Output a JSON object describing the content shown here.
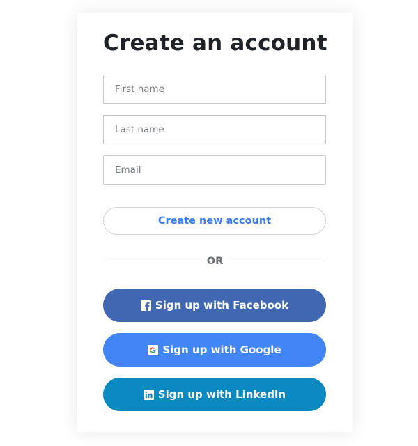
{
  "form": {
    "title": "Create an account",
    "first_name_placeholder": "First name",
    "last_name_placeholder": "Last name",
    "email_placeholder": "Email",
    "submit_label": "Create new account",
    "divider_label": "OR"
  },
  "social": {
    "facebook": {
      "label": "Sign up with Facebook",
      "icon": "facebook-icon",
      "color": "#4267b2"
    },
    "google": {
      "label": "Sign up with Google",
      "icon": "google-icon",
      "color": "#4285f4"
    },
    "linkedin": {
      "label": "Sign up with LinkedIn",
      "icon": "linkedin-icon",
      "color": "#0a8ac0"
    }
  },
  "colors": {
    "accent": "#3d7bea",
    "title": "#1f2328",
    "muted": "#6b6f73"
  }
}
